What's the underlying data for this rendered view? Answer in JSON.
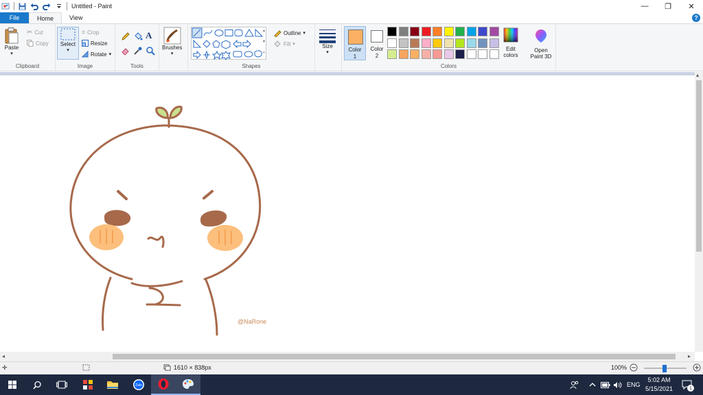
{
  "window": {
    "title": "Untitled - Paint",
    "minimize": "—",
    "restore": "❐",
    "close": "✕"
  },
  "tabs": [
    {
      "label": "File"
    },
    {
      "label": "Home"
    },
    {
      "label": "View"
    }
  ],
  "ribbon": {
    "clipboard": {
      "label": "Clipboard",
      "paste": "Paste",
      "cut": "Cut",
      "copy": "Copy"
    },
    "image": {
      "label": "Image",
      "select": "Select",
      "crop": "Crop",
      "resize": "Resize",
      "rotate": "Rotate"
    },
    "tools": {
      "label": "Tools"
    },
    "brushes": {
      "label": "Brushes"
    },
    "shapes": {
      "label": "Shapes",
      "outline": "Outline",
      "fill": "Fill"
    },
    "size": {
      "label": "Size"
    },
    "colors": {
      "label": "Colors",
      "color1_label": "Color",
      "color1_num": "1",
      "color2_label": "Color",
      "color2_num": "2",
      "color1_value": "#fbb063",
      "color2_value": "#ffffff",
      "edit_label": "Edit",
      "edit_label2": "colors",
      "palette": [
        "#000000",
        "#7f7f7f",
        "#880015",
        "#ed1c24",
        "#ff7f27",
        "#fff200",
        "#22b14c",
        "#00a2e8",
        "#3f48cc",
        "#a349a4",
        "#ffffff",
        "#c3c3c3",
        "#b97a57",
        "#ffaec9",
        "#ffc90e",
        "#efe4b0",
        "#b5e61d",
        "#99d9ea",
        "#7092be",
        "#c8bfe7",
        "#d4ee8f",
        "#f6a55f",
        "#fbb063",
        "#f7b0a8",
        "#f79a94",
        "#e8c8e8",
        "#1c1f4a",
        "#ffffff",
        "#ffffff",
        "#ffffff"
      ]
    },
    "paint3d": {
      "label": "Open",
      "label2": "Paint 3D"
    }
  },
  "drawing": {
    "signature": "@NaRone",
    "line_color": "#a7694a",
    "cheek_color": "#fcbf7c",
    "brow_color": "#a7694a",
    "eye_color": "#a7694a",
    "sprout_color": "#c9e08f"
  },
  "status": {
    "dimensions": "1610 × 838px",
    "zoom": "100%"
  },
  "taskbar": {
    "lang": "ENG",
    "time": "5:02 AM",
    "date": "5/15/2021",
    "notification_count": "1"
  }
}
